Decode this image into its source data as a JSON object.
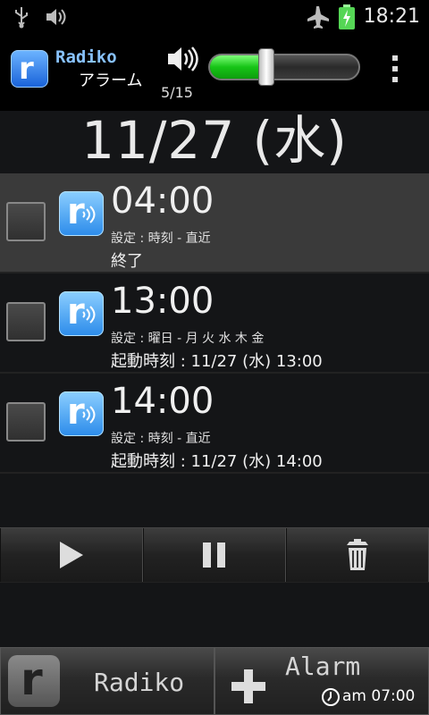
{
  "status_bar": {
    "time": "18:21"
  },
  "app_bar": {
    "title_line1": "Radiko",
    "title_line2": "アラーム",
    "volume_count": "5/15",
    "volume_level": 0.38
  },
  "current_datetime": "11/27 (水) 13:00",
  "alarms": [
    {
      "time": "04:00",
      "setting": "設定 : 時刻 - 直近",
      "status": "終了",
      "checked": false,
      "selected": true
    },
    {
      "time": "13:00",
      "setting": "設定 : 曜日 - 月 火 水 木 金",
      "status": "起動時刻 : 11/27 (水) 13:00",
      "checked": false,
      "selected": false
    },
    {
      "time": "14:00",
      "setting": "設定 : 時刻 - 直近",
      "status": "起動時刻 : 11/27 (水) 14:00",
      "checked": false,
      "selected": false
    }
  ],
  "bottom": {
    "radiko_label": "Radiko",
    "alarm_label": "Alarm",
    "alarm_time": "am 07:00"
  },
  "icons": {
    "usb": "usb-icon",
    "sound": "speaker-icon",
    "airplane": "airplane-icon",
    "battery": "battery-charging-icon",
    "play": "play-icon",
    "pause": "pause-icon",
    "delete": "trash-icon",
    "add": "plus-icon",
    "clock": "clock-icon"
  },
  "colors": {
    "accent_blue": "#88c2ff",
    "volume_green": "#16c416"
  }
}
